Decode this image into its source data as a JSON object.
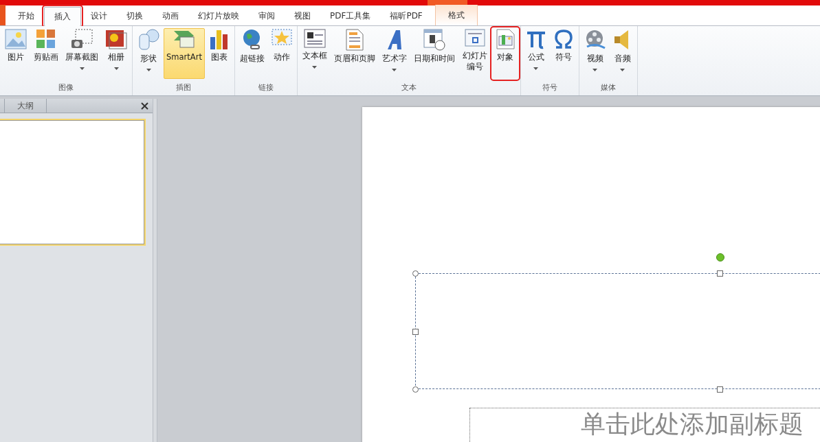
{
  "tabs": [
    {
      "label": "开始",
      "selected": false,
      "kind": "normal",
      "annotated": false
    },
    {
      "label": "插入",
      "selected": true,
      "kind": "normal",
      "annotated": true
    },
    {
      "label": "设计",
      "selected": false,
      "kind": "normal",
      "annotated": false
    },
    {
      "label": "切换",
      "selected": false,
      "kind": "normal",
      "annotated": false
    },
    {
      "label": "动画",
      "selected": false,
      "kind": "normal",
      "annotated": false
    },
    {
      "label": "幻灯片放映",
      "selected": false,
      "kind": "normal",
      "annotated": false
    },
    {
      "label": "审阅",
      "selected": false,
      "kind": "normal",
      "annotated": false
    },
    {
      "label": "视图",
      "selected": false,
      "kind": "normal",
      "annotated": false
    },
    {
      "label": "PDF工具集",
      "selected": false,
      "kind": "normal",
      "annotated": false
    },
    {
      "label": "福昕PDF",
      "selected": false,
      "kind": "normal",
      "annotated": false
    },
    {
      "label": "格式",
      "selected": false,
      "kind": "contextual",
      "annotated": false
    }
  ],
  "ribbon_groups": [
    {
      "label": "图像",
      "buttons": [
        {
          "label": "图片",
          "dropdown": false,
          "highlighted": false,
          "annotated": false
        },
        {
          "label": "剪贴画",
          "dropdown": false,
          "highlighted": false,
          "annotated": false
        },
        {
          "label": "屏幕截图",
          "dropdown": true,
          "highlighted": false,
          "annotated": false
        },
        {
          "label": "相册",
          "dropdown": true,
          "highlighted": false,
          "annotated": false
        }
      ]
    },
    {
      "label": "插图",
      "buttons": [
        {
          "label": "形状",
          "dropdown": true,
          "highlighted": false,
          "annotated": false
        },
        {
          "label": "SmartArt",
          "dropdown": false,
          "highlighted": true,
          "annotated": false
        },
        {
          "label": "图表",
          "dropdown": false,
          "highlighted": false,
          "annotated": false
        }
      ]
    },
    {
      "label": "链接",
      "buttons": [
        {
          "label": "超链接",
          "dropdown": false,
          "highlighted": false,
          "annotated": false
        },
        {
          "label": "动作",
          "dropdown": false,
          "highlighted": false,
          "annotated": false
        }
      ]
    },
    {
      "label": "文本",
      "buttons": [
        {
          "label": "文本框",
          "kind": "single-line",
          "dropdown": true,
          "highlighted": false,
          "annotated": false
        },
        {
          "label": "页眉和页脚",
          "kind": "single-line",
          "dropdown": false,
          "highlighted": false,
          "annotated": false
        },
        {
          "label": "艺术字",
          "kind": "single-line",
          "dropdown": true,
          "highlighted": false,
          "annotated": false
        },
        {
          "label": "日期和时间",
          "kind": "single-line",
          "dropdown": false,
          "highlighted": false,
          "annotated": false
        },
        {
          "label": "幻灯片编号",
          "kind": "two-line",
          "dropdown": false,
          "highlighted": false,
          "annotated": false
        },
        {
          "label": "对象",
          "kind": "single-line",
          "dropdown": false,
          "highlighted": false,
          "annotated": true
        }
      ]
    },
    {
      "label": "符号",
      "buttons": [
        {
          "label": "公式",
          "dropdown": true,
          "highlighted": false,
          "annotated": false
        },
        {
          "label": "符号",
          "dropdown": false,
          "highlighted": false,
          "annotated": false
        }
      ]
    },
    {
      "label": "媒体",
      "buttons": [
        {
          "label": "视频",
          "dropdown": true,
          "highlighted": false,
          "annotated": false
        },
        {
          "label": "音频",
          "dropdown": true,
          "highlighted": false,
          "annotated": false
        }
      ]
    }
  ],
  "slide_pane": {
    "tab": "大纲"
  },
  "slide": {
    "subtitle_placeholder": "单击此处添加副标题"
  }
}
